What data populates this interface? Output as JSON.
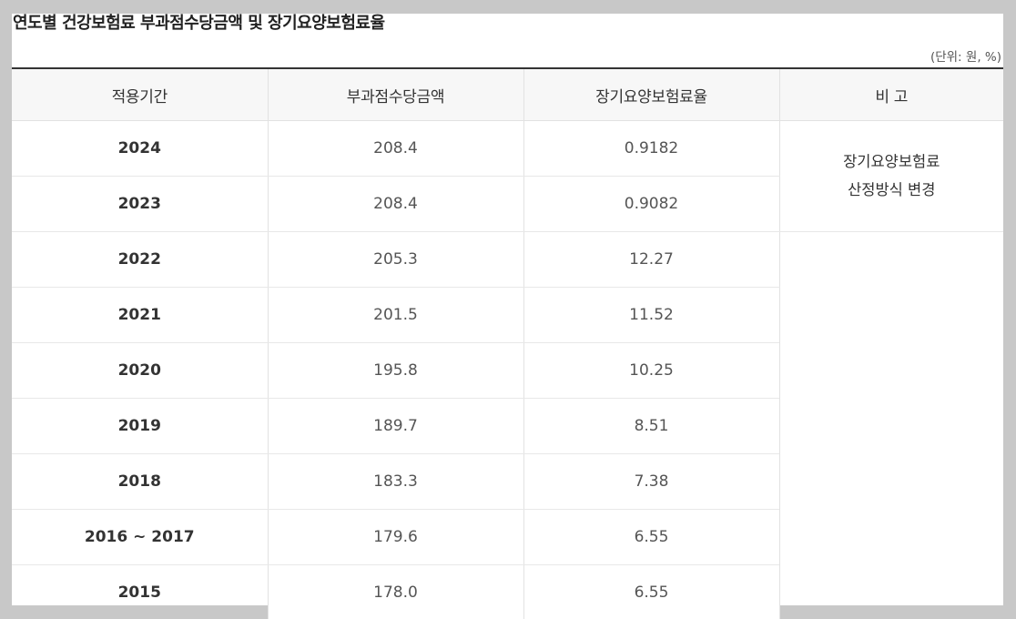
{
  "title": "연도별 건강보험료 부과점수당금액 및 장기요양보험료율",
  "unit": "(단위: 원, %)",
  "table": {
    "headers": [
      "적용기간",
      "부과점수당금액",
      "장기요양보험료율",
      "비 고"
    ],
    "rows": [
      {
        "period": "2024",
        "amount": "208.4",
        "rate": "0.9182"
      },
      {
        "period": "2023",
        "amount": "208.4",
        "rate": "0.9082"
      },
      {
        "period": "2022",
        "amount": "205.3",
        "rate": "12.27"
      },
      {
        "period": "2021",
        "amount": "201.5",
        "rate": "11.52"
      },
      {
        "period": "2020",
        "amount": "195.8",
        "rate": "10.25"
      },
      {
        "period": "2019",
        "amount": "189.7",
        "rate": "8.51"
      },
      {
        "period": "2018",
        "amount": "183.3",
        "rate": "7.38"
      },
      {
        "period": "2016 ~ 2017",
        "amount": "179.6",
        "rate": "6.55"
      },
      {
        "period": "2015",
        "amount": "178.0",
        "rate": "6.55"
      }
    ],
    "note": {
      "line1": "장기요양보험료",
      "line2": "산정방식 변경"
    }
  }
}
